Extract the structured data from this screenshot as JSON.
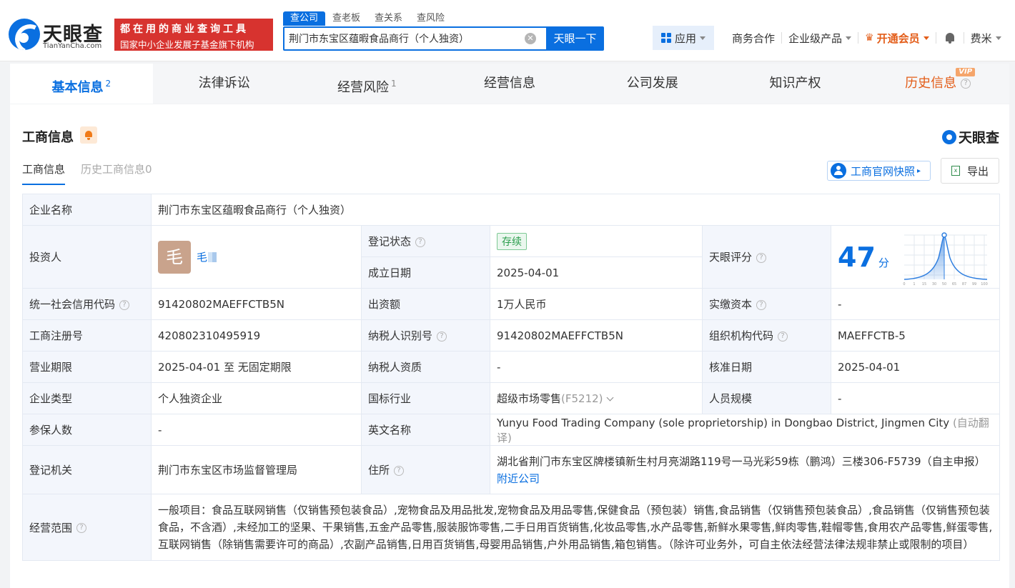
{
  "header": {
    "logo_text": "天眼查",
    "logo_sub": "TianYanCha.com",
    "slogan_line1": "都在用的商业查询工具",
    "slogan_line2": "国家中小企业发展子基金旗下机构",
    "search_tabs": [
      "查公司",
      "查老板",
      "查关系",
      "查风险"
    ],
    "search_value": "荆门市东宝区蕴暇食品商行（个人独资）",
    "search_button": "天眼一下",
    "apps_label": "应用",
    "nav": [
      "商务合作",
      "企业级产品"
    ],
    "vip_label": "开通会员",
    "user": "费米"
  },
  "tabs": [
    {
      "label": "基本信息",
      "count": "2"
    },
    {
      "label": "法律诉讼",
      "count": ""
    },
    {
      "label": "经营风险",
      "count": "1"
    },
    {
      "label": "经营信息",
      "count": ""
    },
    {
      "label": "公司发展",
      "count": ""
    },
    {
      "label": "知识产权",
      "count": ""
    },
    {
      "label": "历史信息",
      "count": "",
      "badge": "VIP"
    }
  ],
  "section": {
    "title": "工商信息",
    "brand": "天眼查",
    "subtabs": [
      "工商信息",
      "历史工商信息0"
    ],
    "snapshot_button": "工商官网快照",
    "export_button": "导出"
  },
  "info": {
    "company_name_label": "企业名称",
    "company_name": "荆门市东宝区蕴暇食品商行（个人独资）",
    "investor_label": "投资人",
    "investor_avatar": "毛",
    "investor_name": "毛",
    "reg_status_label": "登记状态",
    "reg_status": "存续",
    "found_date_label": "成立日期",
    "found_date": "2025-04-01",
    "score_label": "天眼评分",
    "score": "47",
    "score_unit": "分",
    "score_axis": [
      "0",
      "1",
      "15",
      "30",
      "50",
      "65",
      "87",
      "99",
      "100"
    ],
    "credit_code_label": "统一社会信用代码",
    "credit_code": "91420802MAEFFCTB5N",
    "capital_label": "出资额",
    "capital": "1万人民币",
    "paid_capital_label": "实缴资本",
    "paid_capital": "-",
    "reg_no_label": "工商注册号",
    "reg_no": "420802310495919",
    "taxpayer_id_label": "纳税人识别号",
    "taxpayer_id": "91420802MAEFFCTB5N",
    "org_code_label": "组织机构代码",
    "org_code": "MAEFFCTB-5",
    "term_label": "营业期限",
    "term": "2025-04-01 至 无固定期限",
    "taxpayer_qual_label": "纳税人资质",
    "taxpayer_qual": "-",
    "approve_date_label": "核准日期",
    "approve_date": "2025-04-01",
    "type_label": "企业类型",
    "type": "个人独资企业",
    "industry_label": "国标行业",
    "industry": "超级市场零售",
    "industry_code": "(F5212)",
    "staff_label": "人员规模",
    "staff": "-",
    "insured_label": "参保人数",
    "insured": "-",
    "en_name_label": "英文名称",
    "en_name": "Yunyu Food Trading Company (sole proprietorship) in Dongbao District, Jingmen City",
    "en_name_note": "(自动翻译)",
    "authority_label": "登记机关",
    "authority": "荆门市东宝区市场监督管理局",
    "address_label": "住所",
    "address": "湖北省荆门市东宝区牌楼镇新生村月亮湖路119号一马光彩59栋（鹏鸿）三楼306-F5739（自主申报）",
    "nearby_link": "附近公司",
    "scope_label": "经营范围",
    "scope": "一般项目：食品互联网销售（仅销售预包装食品）,宠物食品及用品批发,宠物食品及用品零售,保健食品（预包装）销售,食品销售（仅销售预包装食品）,食品销售（仅销售预包装食品，不含酒）,未经加工的坚果、干果销售,五金产品零售,服装服饰零售,二手日用百货销售,化妆品零售,水产品零售,新鲜水果零售,鲜肉零售,鞋帽零售,食用农产品零售,鲜蛋零售,互联网销售（除销售需要许可的商品）,农副产品销售,日用百货销售,母婴用品销售,户外用品销售,箱包销售。（除许可业务外，可自主依法经营法律法规非禁止或限制的项目）"
  },
  "colors": {
    "accent": "#0a6fe0",
    "vip": "#e35d19",
    "status_green": "#2a9d4c"
  }
}
